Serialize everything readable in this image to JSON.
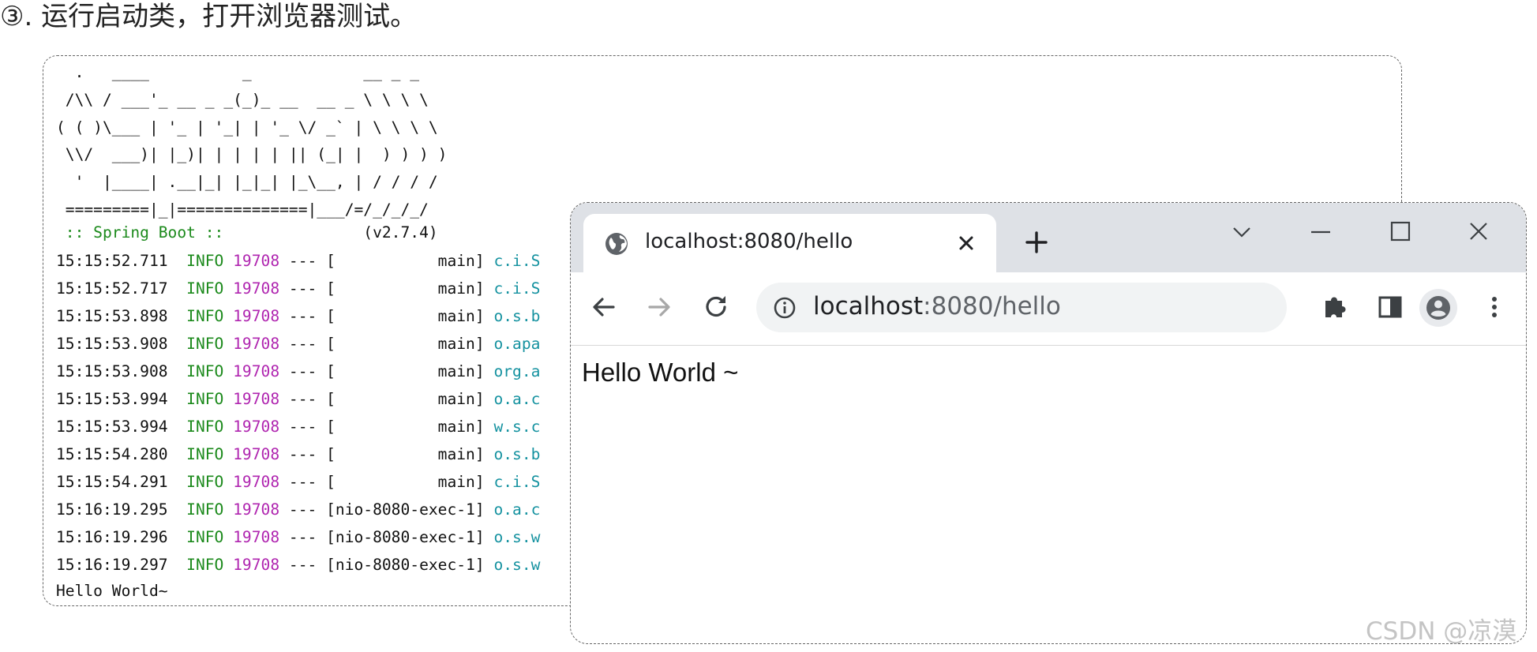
{
  "heading": "③. 运行启动类，打开浏览器测试。",
  "console": {
    "banner": "  .   ____          _            __ _ _\n /\\\\ / ___'_ __ _ _(_)_ __  __ _ \\ \\ \\ \\\n( ( )\\___ | '_ | '_| | '_ \\/ _` | \\ \\ \\ \\\n \\\\/  ___)| |_)| | | | | || (_| |  ) ) ) )\n  '  |____| .__|_| |_|_| |_\\__, | / / / /\n =========|_|==============|___/=/_/_/_/",
    "spring_boot_label": " :: Spring Boot :: ",
    "spring_boot_version": "              (v2.7.4)",
    "log_rows": [
      {
        "time": "15:15:52.711",
        "level": "INFO",
        "pid": "19708",
        "sep": "---",
        "thread": "[           main]",
        "logger": "c.i.S"
      },
      {
        "time": "15:15:52.717",
        "level": "INFO",
        "pid": "19708",
        "sep": "---",
        "thread": "[           main]",
        "logger": "c.i.S"
      },
      {
        "time": "15:15:53.898",
        "level": "INFO",
        "pid": "19708",
        "sep": "---",
        "thread": "[           main]",
        "logger": "o.s.b"
      },
      {
        "time": "15:15:53.908",
        "level": "INFO",
        "pid": "19708",
        "sep": "---",
        "thread": "[           main]",
        "logger": "o.apa"
      },
      {
        "time": "15:15:53.908",
        "level": "INFO",
        "pid": "19708",
        "sep": "---",
        "thread": "[           main]",
        "logger": "org.a"
      },
      {
        "time": "15:15:53.994",
        "level": "INFO",
        "pid": "19708",
        "sep": "---",
        "thread": "[           main]",
        "logger": "o.a.c"
      },
      {
        "time": "15:15:53.994",
        "level": "INFO",
        "pid": "19708",
        "sep": "---",
        "thread": "[           main]",
        "logger": "w.s.c"
      },
      {
        "time": "15:15:54.280",
        "level": "INFO",
        "pid": "19708",
        "sep": "---",
        "thread": "[           main]",
        "logger": "o.s.b"
      },
      {
        "time": "15:15:54.291",
        "level": "INFO",
        "pid": "19708",
        "sep": "---",
        "thread": "[           main]",
        "logger": "c.i.S"
      },
      {
        "time": "15:16:19.295",
        "level": "INFO",
        "pid": "19708",
        "sep": "---",
        "thread": "[nio-8080-exec-1]",
        "logger": "o.a.c"
      },
      {
        "time": "15:16:19.296",
        "level": "INFO",
        "pid": "19708",
        "sep": "---",
        "thread": "[nio-8080-exec-1]",
        "logger": "o.s.w"
      },
      {
        "time": "15:16:19.297",
        "level": "INFO",
        "pid": "19708",
        "sep": "---",
        "thread": "[nio-8080-exec-1]",
        "logger": "o.s.w"
      }
    ],
    "final_line": "Hello World~"
  },
  "browser": {
    "tab_title": "localhost:8080/hello",
    "tab_icon": "globe-icon",
    "url_host": "localhost",
    "url_rest": ":8080/hello",
    "page_text": "Hello World ~",
    "icons": [
      "back-arrow-icon",
      "forward-arrow-icon",
      "reload-icon",
      "info-icon",
      "extensions-puzzle-icon",
      "side-panel-icon",
      "profile-avatar-icon",
      "more-menu-icon",
      "minimize-icon",
      "maximize-icon",
      "close-window-icon",
      "tab-search-chevron-icon"
    ]
  },
  "watermark": "CSDN @凉漠",
  "colors": {
    "info_level": "#1c8a1c",
    "pid": "#b026b0",
    "logger": "#1592a0",
    "tab_bar": "#dee1e6",
    "omnibox": "#f1f3f4"
  }
}
